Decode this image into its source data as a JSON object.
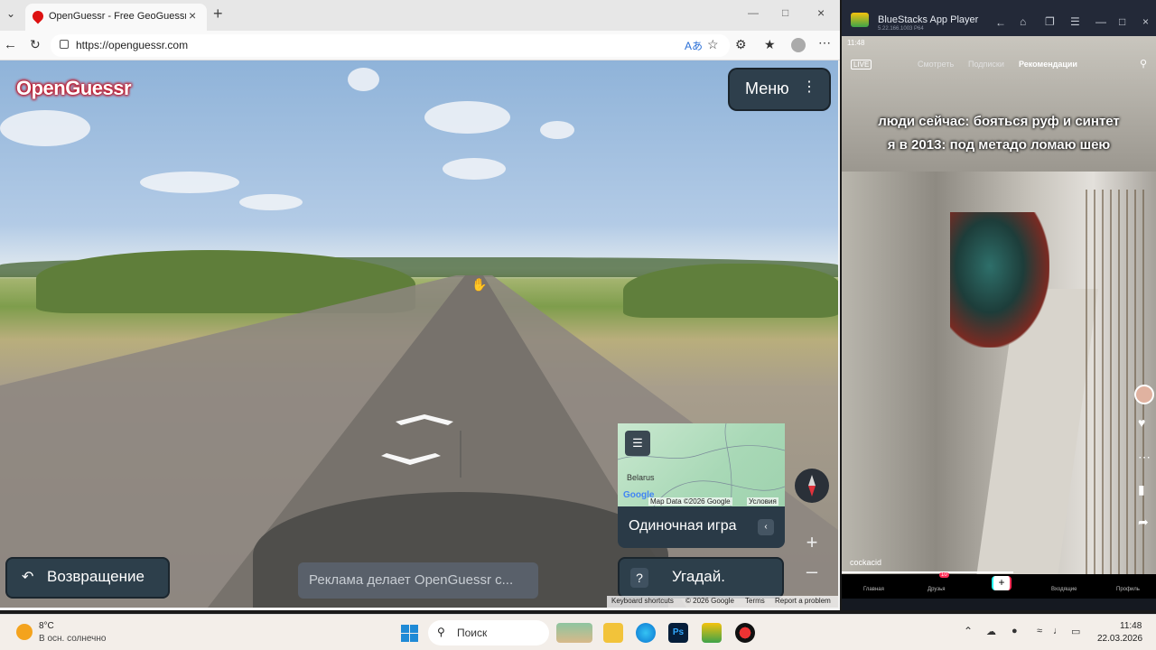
{
  "browser": {
    "tab_title": "OpenGuessr - Free GeoGuessr Alte",
    "url": "https://openguessr.com"
  },
  "game": {
    "logo": "OpenGuessr",
    "menu_label": "Меню",
    "minimap": {
      "country_label": "Belarus",
      "google_label": "Google",
      "map_data": "Map Data ©2026 Google",
      "terms": "Условия"
    },
    "mode_label": "Одиночная игра",
    "return_label": "Возвращение",
    "ad_label": "Реклама делает OpenGuessr с...",
    "guess_label": "Угадай.",
    "guess_help": "?",
    "footer": {
      "shortcuts": "Keyboard shortcuts",
      "copyright": "© 2026 Google",
      "terms": "Terms",
      "report": "Report a problem"
    }
  },
  "bluestacks": {
    "title": "BlueStacks App Player",
    "version": "5.22.166.1003 P64",
    "phone": {
      "status_time": "11:48",
      "live": "LIVE",
      "tabs": [
        "Смотреть",
        "Подписки",
        "Рекомендации"
      ],
      "caption_line1": "люди сейчас: бояться руф и синтет",
      "caption_line2": "я в 2013: под метадо ломаю шею",
      "author": "cockacid",
      "nav": [
        "Главная",
        "Друзья",
        "Входящие",
        "Профиль"
      ],
      "badge": "10"
    }
  },
  "taskbar": {
    "weather_temp": "8°C",
    "weather_desc": "В осн. солнечно",
    "search_label": "Поиск",
    "time": "11:48",
    "date": "22.03.2026"
  }
}
